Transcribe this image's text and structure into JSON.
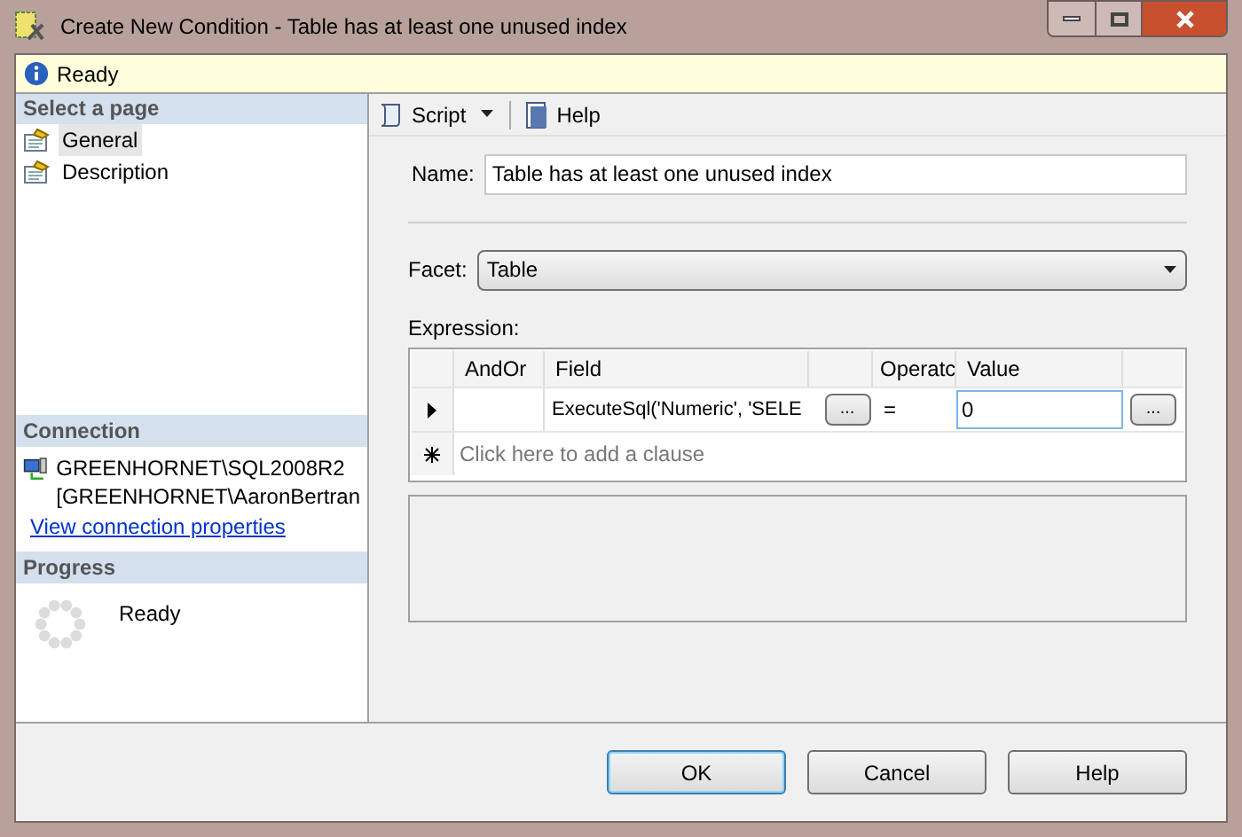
{
  "window": {
    "title": "Create New Condition - Table has at least one unused index"
  },
  "status": {
    "text": "Ready"
  },
  "sidebar": {
    "header": "Select a page",
    "items": [
      {
        "label": "General",
        "selected": true
      },
      {
        "label": "Description",
        "selected": false
      }
    ]
  },
  "connection": {
    "header": "Connection",
    "server": "GREENHORNET\\SQL2008R2",
    "user": "[GREENHORNET\\AaronBertran",
    "link": "View connection properties"
  },
  "progress": {
    "header": "Progress",
    "text": "Ready"
  },
  "toolbar": {
    "script": "Script",
    "help": "Help"
  },
  "form": {
    "name_label": "Name:",
    "name_value": "Table has at least one unused index",
    "facet_label": "Facet:",
    "facet_value": "Table",
    "expression_label": "Expression:"
  },
  "grid": {
    "columns": [
      "AndOr",
      "Field",
      "Operatc",
      "Value"
    ],
    "rows": [
      {
        "andor": "",
        "field": "ExecuteSql('Numeric', 'SELE",
        "operator": "=",
        "value": "0",
        "selected": true
      }
    ],
    "new_row": "Click here to add a clause",
    "ellipsis": "..."
  },
  "buttons": [
    "OK",
    "Cancel",
    "Help"
  ]
}
